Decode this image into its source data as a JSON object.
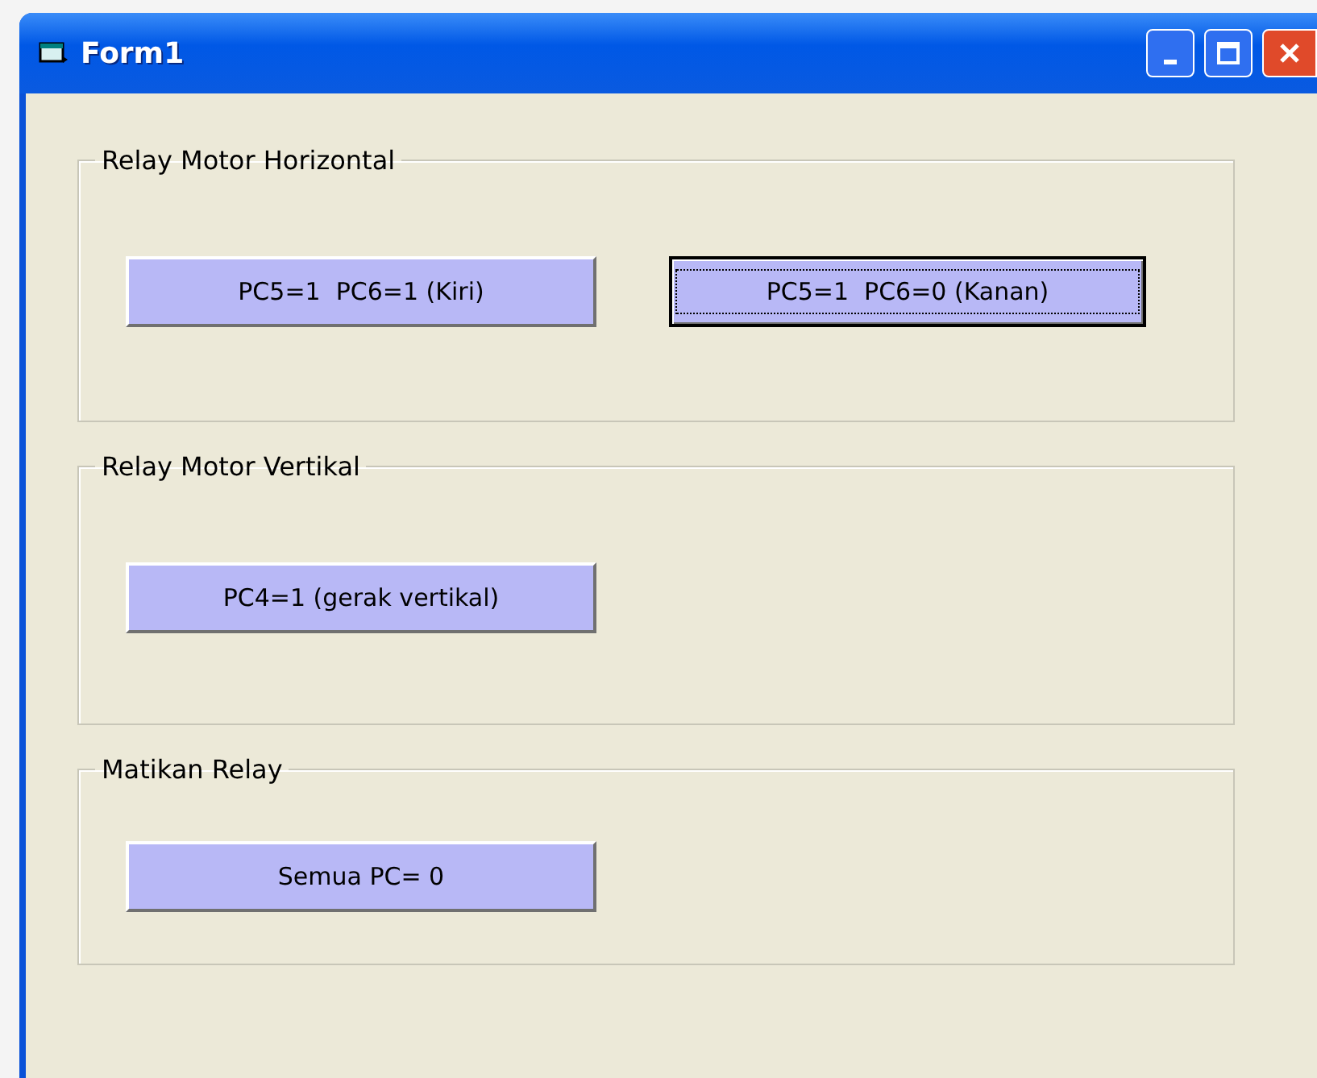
{
  "window": {
    "title": "Form1"
  },
  "groups": [
    {
      "title": "Relay Motor Horizontal",
      "buttons": [
        {
          "label": "PC5=1  PC6=1 (Kiri)",
          "focused": false
        },
        {
          "label": "PC5=1  PC6=0 (Kanan)",
          "focused": true
        }
      ]
    },
    {
      "title": "Relay Motor Vertikal",
      "buttons": [
        {
          "label": "PC4=1 (gerak vertikal)",
          "focused": false
        }
      ]
    },
    {
      "title": "Matikan Relay",
      "buttons": [
        {
          "label": "Semua PC= 0",
          "focused": false
        }
      ]
    }
  ]
}
